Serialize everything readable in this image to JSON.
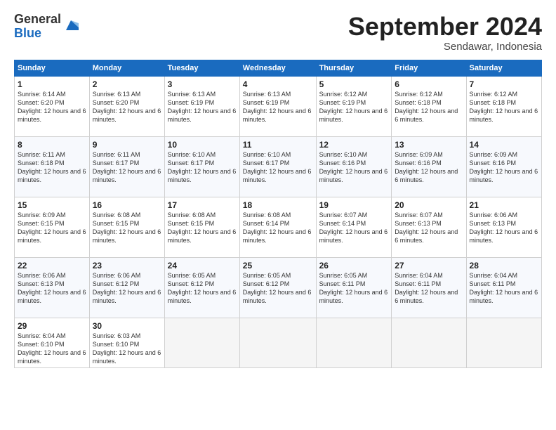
{
  "logo": {
    "general": "General",
    "blue": "Blue"
  },
  "header": {
    "month": "September 2024",
    "location": "Sendawar, Indonesia"
  },
  "columns": [
    "Sunday",
    "Monday",
    "Tuesday",
    "Wednesday",
    "Thursday",
    "Friday",
    "Saturday"
  ],
  "weeks": [
    [
      {
        "day": "1",
        "sunrise": "6:14 AM",
        "sunset": "6:20 PM",
        "daylight": "12 hours and 6 minutes."
      },
      {
        "day": "2",
        "sunrise": "6:13 AM",
        "sunset": "6:20 PM",
        "daylight": "12 hours and 6 minutes."
      },
      {
        "day": "3",
        "sunrise": "6:13 AM",
        "sunset": "6:19 PM",
        "daylight": "12 hours and 6 minutes."
      },
      {
        "day": "4",
        "sunrise": "6:13 AM",
        "sunset": "6:19 PM",
        "daylight": "12 hours and 6 minutes."
      },
      {
        "day": "5",
        "sunrise": "6:12 AM",
        "sunset": "6:19 PM",
        "daylight": "12 hours and 6 minutes."
      },
      {
        "day": "6",
        "sunrise": "6:12 AM",
        "sunset": "6:18 PM",
        "daylight": "12 hours and 6 minutes."
      },
      {
        "day": "7",
        "sunrise": "6:12 AM",
        "sunset": "6:18 PM",
        "daylight": "12 hours and 6 minutes."
      }
    ],
    [
      {
        "day": "8",
        "sunrise": "6:11 AM",
        "sunset": "6:18 PM",
        "daylight": "12 hours and 6 minutes."
      },
      {
        "day": "9",
        "sunrise": "6:11 AM",
        "sunset": "6:17 PM",
        "daylight": "12 hours and 6 minutes."
      },
      {
        "day": "10",
        "sunrise": "6:10 AM",
        "sunset": "6:17 PM",
        "daylight": "12 hours and 6 minutes."
      },
      {
        "day": "11",
        "sunrise": "6:10 AM",
        "sunset": "6:17 PM",
        "daylight": "12 hours and 6 minutes."
      },
      {
        "day": "12",
        "sunrise": "6:10 AM",
        "sunset": "6:16 PM",
        "daylight": "12 hours and 6 minutes."
      },
      {
        "day": "13",
        "sunrise": "6:09 AM",
        "sunset": "6:16 PM",
        "daylight": "12 hours and 6 minutes."
      },
      {
        "day": "14",
        "sunrise": "6:09 AM",
        "sunset": "6:16 PM",
        "daylight": "12 hours and 6 minutes."
      }
    ],
    [
      {
        "day": "15",
        "sunrise": "6:09 AM",
        "sunset": "6:15 PM",
        "daylight": "12 hours and 6 minutes."
      },
      {
        "day": "16",
        "sunrise": "6:08 AM",
        "sunset": "6:15 PM",
        "daylight": "12 hours and 6 minutes."
      },
      {
        "day": "17",
        "sunrise": "6:08 AM",
        "sunset": "6:15 PM",
        "daylight": "12 hours and 6 minutes."
      },
      {
        "day": "18",
        "sunrise": "6:08 AM",
        "sunset": "6:14 PM",
        "daylight": "12 hours and 6 minutes."
      },
      {
        "day": "19",
        "sunrise": "6:07 AM",
        "sunset": "6:14 PM",
        "daylight": "12 hours and 6 minutes."
      },
      {
        "day": "20",
        "sunrise": "6:07 AM",
        "sunset": "6:13 PM",
        "daylight": "12 hours and 6 minutes."
      },
      {
        "day": "21",
        "sunrise": "6:06 AM",
        "sunset": "6:13 PM",
        "daylight": "12 hours and 6 minutes."
      }
    ],
    [
      {
        "day": "22",
        "sunrise": "6:06 AM",
        "sunset": "6:13 PM",
        "daylight": "12 hours and 6 minutes."
      },
      {
        "day": "23",
        "sunrise": "6:06 AM",
        "sunset": "6:12 PM",
        "daylight": "12 hours and 6 minutes."
      },
      {
        "day": "24",
        "sunrise": "6:05 AM",
        "sunset": "6:12 PM",
        "daylight": "12 hours and 6 minutes."
      },
      {
        "day": "25",
        "sunrise": "6:05 AM",
        "sunset": "6:12 PM",
        "daylight": "12 hours and 6 minutes."
      },
      {
        "day": "26",
        "sunrise": "6:05 AM",
        "sunset": "6:11 PM",
        "daylight": "12 hours and 6 minutes."
      },
      {
        "day": "27",
        "sunrise": "6:04 AM",
        "sunset": "6:11 PM",
        "daylight": "12 hours and 6 minutes."
      },
      {
        "day": "28",
        "sunrise": "6:04 AM",
        "sunset": "6:11 PM",
        "daylight": "12 hours and 6 minutes."
      }
    ],
    [
      {
        "day": "29",
        "sunrise": "6:04 AM",
        "sunset": "6:10 PM",
        "daylight": "12 hours and 6 minutes."
      },
      {
        "day": "30",
        "sunrise": "6:03 AM",
        "sunset": "6:10 PM",
        "daylight": "12 hours and 6 minutes."
      },
      null,
      null,
      null,
      null,
      null
    ]
  ]
}
